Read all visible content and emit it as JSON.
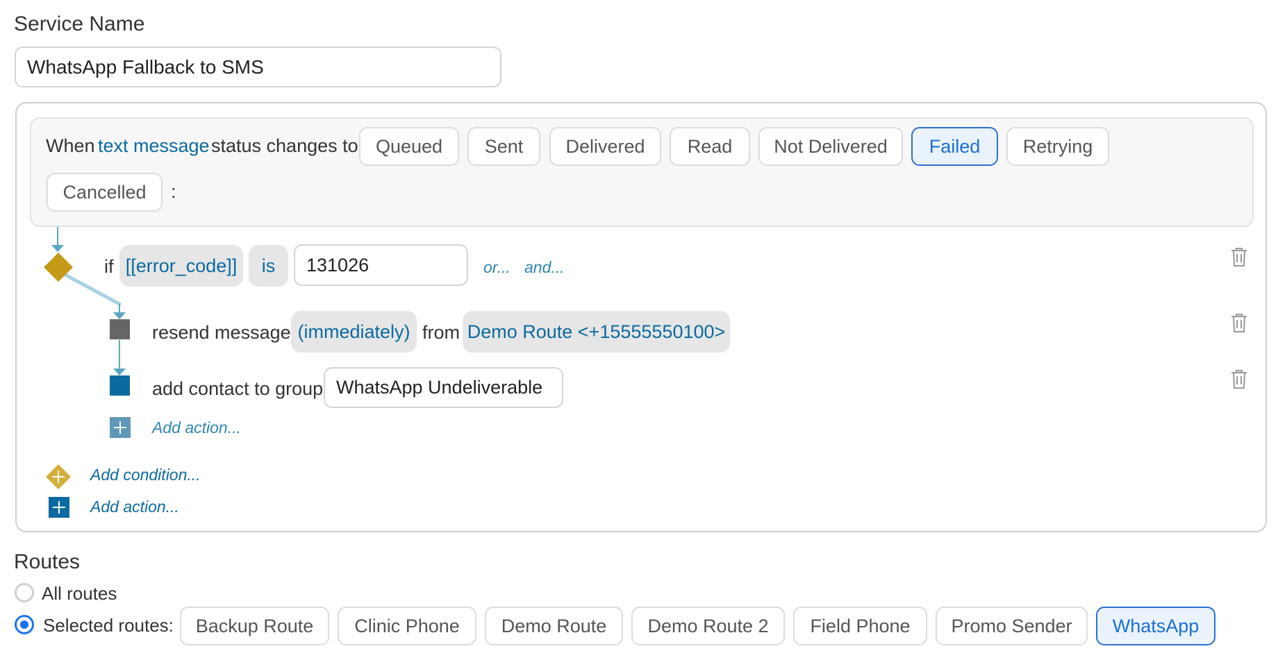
{
  "service": {
    "label": "Service Name",
    "value": "WhatsApp Fallback to SMS"
  },
  "trigger": {
    "when": "When",
    "subject_link": "text message",
    "status_text": "status changes to",
    "colon": ":",
    "statuses": [
      {
        "label": "Queued",
        "selected": false
      },
      {
        "label": "Sent",
        "selected": false
      },
      {
        "label": "Delivered",
        "selected": false
      },
      {
        "label": "Read",
        "selected": false
      },
      {
        "label": "Not Delivered",
        "selected": false
      },
      {
        "label": "Failed",
        "selected": true
      },
      {
        "label": "Retrying",
        "selected": false
      },
      {
        "label": "Cancelled",
        "selected": false
      }
    ]
  },
  "condition": {
    "if": "if",
    "field": "[[error_code]]",
    "operator": "is",
    "value": "131026",
    "or": "or...",
    "and": "and..."
  },
  "actions": {
    "resend": {
      "text": "resend message",
      "timing": "(immediately)",
      "from": "from",
      "route": "Demo Route <+15555550100>"
    },
    "add_group": {
      "text": "add contact to group",
      "group": "WhatsApp Undeliverable"
    },
    "add_action_nested": "Add action...",
    "add_condition": "Add condition...",
    "add_action": "Add action..."
  },
  "routes": {
    "label": "Routes",
    "all": "All routes",
    "selected": "Selected routes:",
    "mode": "selected",
    "items": [
      {
        "label": "Backup Route",
        "selected": false
      },
      {
        "label": "Clinic Phone",
        "selected": false
      },
      {
        "label": "Demo Route",
        "selected": false
      },
      {
        "label": "Demo Route 2",
        "selected": false
      },
      {
        "label": "Field Phone",
        "selected": false
      },
      {
        "label": "Promo Sender",
        "selected": false
      },
      {
        "label": "WhatsApp",
        "selected": true
      }
    ]
  },
  "colors": {
    "accent": "#1a73e8",
    "link": "#0b6a9f",
    "condition_diamond": "#c49a16",
    "action_gray": "#666666",
    "action_blue": "#0b6a9f"
  }
}
